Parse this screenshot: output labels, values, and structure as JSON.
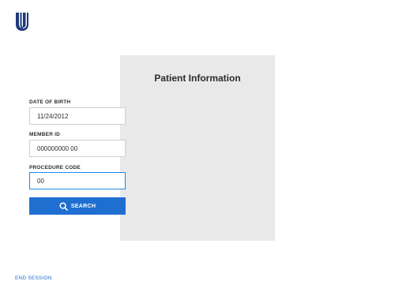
{
  "brand": {
    "logo_icon": "uhc-shield-logo",
    "color": "#1f3a7a"
  },
  "card": {
    "title": "Patient Information",
    "fields": [
      {
        "label": "DATE OF BIRTH",
        "value": "11/24/2012"
      },
      {
        "label": "MEMBER ID",
        "value": "000000000 00"
      },
      {
        "label": "PROCEDURE CODE",
        "value": "00"
      }
    ],
    "search_button": {
      "label": "SEARCH",
      "icon": "search-icon"
    }
  },
  "footer": {
    "end_session_label": "END SESSION"
  },
  "colors": {
    "accent": "#1f6fd1",
    "focus_border": "#1e88e5",
    "card_background": "#e9e9e9"
  }
}
